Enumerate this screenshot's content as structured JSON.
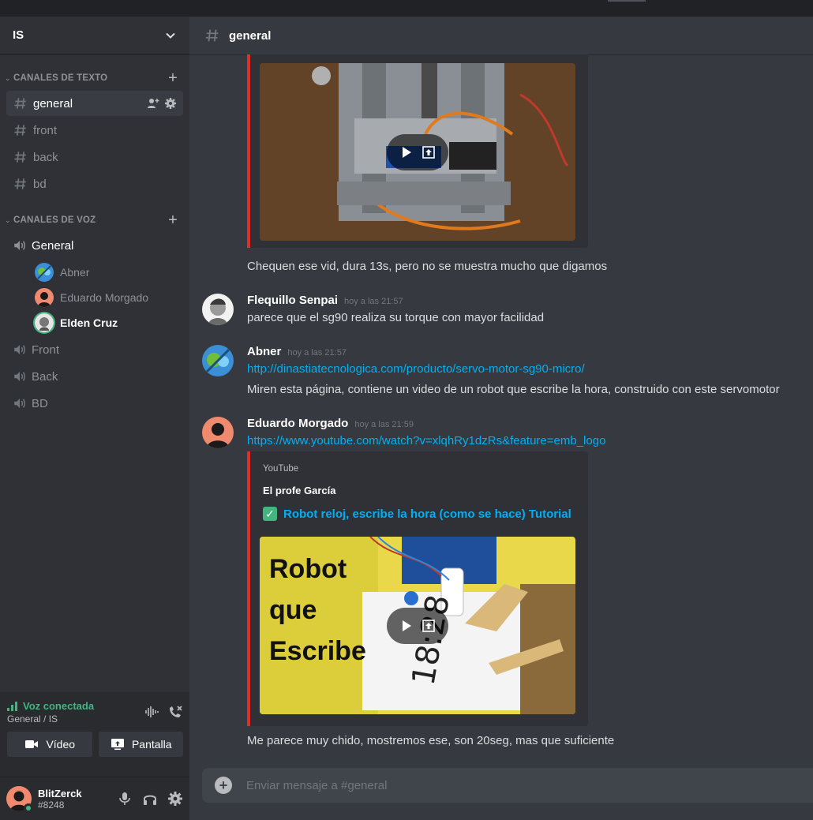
{
  "guild": {
    "name": "IS"
  },
  "categories": {
    "text": {
      "label": "CANALES DE TEXTO"
    },
    "voice": {
      "label": "CANALES DE VOZ"
    }
  },
  "text_channels": [
    {
      "name": "general",
      "active": true
    },
    {
      "name": "front"
    },
    {
      "name": "back"
    },
    {
      "name": "bd"
    }
  ],
  "voice_channels": [
    {
      "name": "General",
      "users": [
        "Abner",
        "Eduardo Morgado",
        "Elden Cruz"
      ]
    },
    {
      "name": "Front"
    },
    {
      "name": "Back"
    },
    {
      "name": "BD"
    }
  ],
  "voice_panel": {
    "status": "Voz conectada",
    "location": "General / IS",
    "video_label": "Vídeo",
    "screen_label": "Pantalla"
  },
  "user": {
    "name": "BlitZerck",
    "tag": "#8248"
  },
  "channel_header": {
    "title": "general"
  },
  "messages": [
    {
      "text": "Chequen ese vid, dura 13s, pero no se muestra mucho que digamos"
    },
    {
      "author": "Flequillo Senpai",
      "time": "hoy a las 21:57",
      "text": "parece que el sg90 realiza su torque con mayor facilidad"
    },
    {
      "author": "Abner",
      "time": "hoy a las 21:57",
      "link": "http://dinastiatecnologica.com/producto/servo-motor-sg90-micro/",
      "text": "Miren esta página, contiene un video de un robot que escribe la hora, construido con este servomotor"
    },
    {
      "author": "Eduardo Morgado",
      "time": "hoy a las 21:59",
      "link": "https://www.youtube.com/watch?v=xlqhRy1dzRs&feature=emb_logo"
    }
  ],
  "embed": {
    "provider": "YouTube",
    "author": "El profe García",
    "title": "Robot reloj, escribe la hora (como se hace) Tutorial",
    "thumb_words": [
      "Robot",
      "que",
      "Escribe"
    ],
    "thumb_clock": "18:28"
  },
  "last_message": {
    "text": "Me parece muy chido, mostremos ese, son 20seg, mas que suficiente"
  },
  "composer": {
    "placeholder": "Enviar mensaje a #general"
  },
  "colors": {
    "accent_green": "#43b581",
    "link": "#00b0f4",
    "embed_border": "#e52d27"
  }
}
